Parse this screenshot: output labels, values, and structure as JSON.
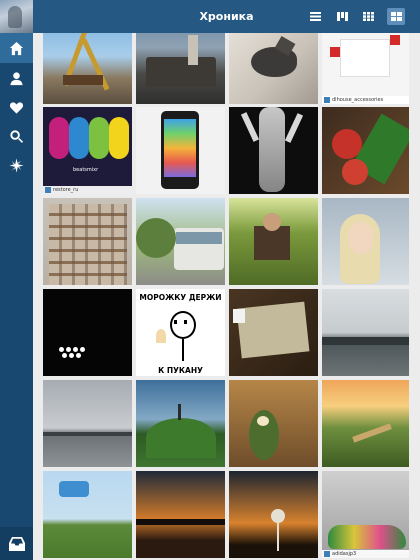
{
  "topbar": {
    "title": "Хроника",
    "view_modes": [
      "list-view-icon",
      "columns-view-icon",
      "grid-small-view-icon",
      "grid-large-view-icon"
    ],
    "selected_view": "grid-large-view-icon"
  },
  "sidebar": {
    "items": [
      {
        "icon": "home-icon",
        "active": true
      },
      {
        "icon": "profile-icon",
        "active": false
      },
      {
        "icon": "heart-icon",
        "active": false
      },
      {
        "icon": "search-icon",
        "active": false
      },
      {
        "icon": "compass-icon",
        "active": false
      }
    ],
    "bottom_icon": "inbox-icon"
  },
  "photos": [
    {
      "owner": ""
    },
    {
      "owner": ""
    },
    {
      "owner": ""
    },
    {
      "owner": "dlhouse_accessories"
    },
    {
      "owner": "restore_ru"
    },
    {
      "owner": ""
    },
    {
      "owner": ""
    },
    {
      "owner": ""
    },
    {
      "owner": ""
    },
    {
      "owner": ""
    },
    {
      "owner": ""
    },
    {
      "owner": ""
    },
    {
      "owner": ""
    },
    {
      "owner": ""
    },
    {
      "owner": ""
    },
    {
      "owner": ""
    },
    {
      "owner": ""
    },
    {
      "owner": ""
    },
    {
      "owner": ""
    },
    {
      "owner": ""
    },
    {
      "owner": ""
    },
    {
      "owner": ""
    },
    {
      "owner": ""
    },
    {
      "owner": "adidasjp3"
    }
  ],
  "meme": {
    "top_text": "МОРОЖКУ ДЕРЖИ",
    "bottom_text": "К ПУКАНУ ПРИЛОЖИ"
  },
  "beats_caption": "beatsmixr",
  "colors": {
    "sidebar": "#18486f",
    "topbar": "#255983",
    "active_nav": "#2f6c9c"
  }
}
